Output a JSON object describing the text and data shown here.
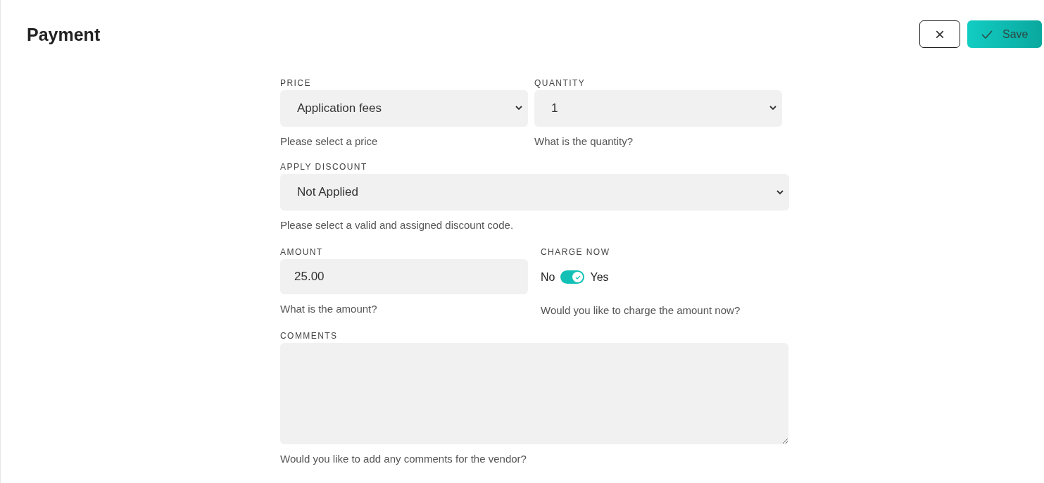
{
  "title": "Payment",
  "actions": {
    "close_icon": "×",
    "save_label": "Save"
  },
  "price": {
    "label": "PRICE",
    "value": "Application fees",
    "help": "Please select a price"
  },
  "quantity": {
    "label": "QUANTITY",
    "value": "1",
    "help": "What is the quantity?"
  },
  "discount": {
    "label": "APPLY DISCOUNT",
    "value": "Not Applied",
    "help": "Please select a valid and assigned discount code."
  },
  "amount": {
    "label": "AMOUNT",
    "value": "25.00",
    "help": "What is the amount?"
  },
  "charge_now": {
    "label": "CHARGE NOW",
    "off_label": "No",
    "on_label": "Yes",
    "on": true,
    "help": "Would you like to charge the amount now?"
  },
  "comments": {
    "label": "COMMENTS",
    "help": "Would you like to add any comments for the vendor?"
  }
}
